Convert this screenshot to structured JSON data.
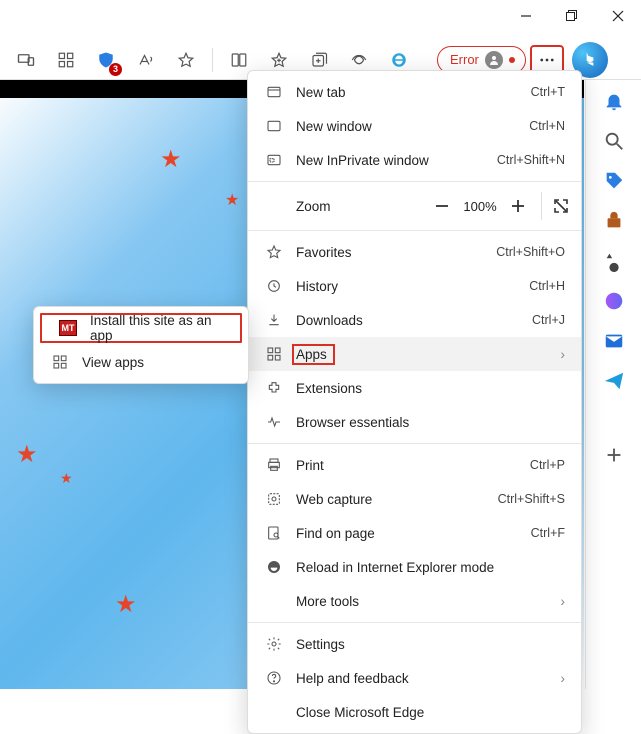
{
  "window_controls": {
    "minimize": "–",
    "restore": "❐",
    "close": "✕"
  },
  "toolbar": {
    "shield_badge": "3",
    "error_label": "Error"
  },
  "submenu": {
    "install_label": "Install this site as an app",
    "view_apps_label": "View apps",
    "mt_badge": "MT"
  },
  "menu": {
    "new_tab": {
      "label": "New tab",
      "shortcut": "Ctrl+T"
    },
    "new_window": {
      "label": "New window",
      "shortcut": "Ctrl+N"
    },
    "new_inprivate": {
      "label": "New InPrivate window",
      "shortcut": "Ctrl+Shift+N"
    },
    "zoom": {
      "label": "Zoom",
      "value": "100%"
    },
    "favorites": {
      "label": "Favorites",
      "shortcut": "Ctrl+Shift+O"
    },
    "history": {
      "label": "History",
      "shortcut": "Ctrl+H"
    },
    "downloads": {
      "label": "Downloads",
      "shortcut": "Ctrl+J"
    },
    "apps": {
      "label": "Apps"
    },
    "extensions": {
      "label": "Extensions"
    },
    "essentials": {
      "label": "Browser essentials"
    },
    "print": {
      "label": "Print",
      "shortcut": "Ctrl+P"
    },
    "capture": {
      "label": "Web capture",
      "shortcut": "Ctrl+Shift+S"
    },
    "find": {
      "label": "Find on page",
      "shortcut": "Ctrl+F"
    },
    "reload_ie": {
      "label": "Reload in Internet Explorer mode"
    },
    "more_tools": {
      "label": "More tools"
    },
    "settings": {
      "label": "Settings"
    },
    "help": {
      "label": "Help and feedback"
    },
    "close_edge": {
      "label": "Close Microsoft Edge"
    }
  }
}
